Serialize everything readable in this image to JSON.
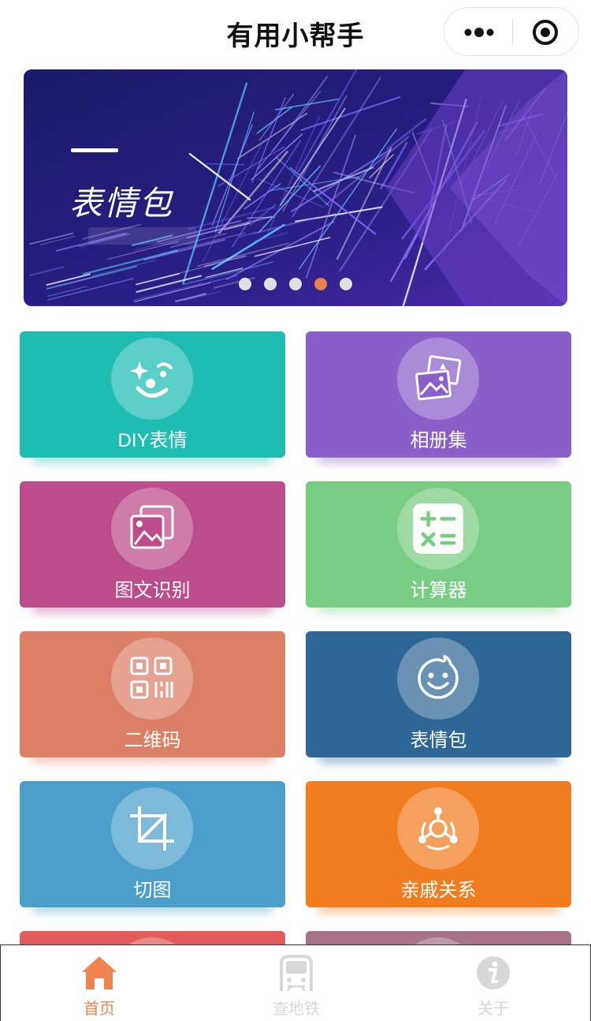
{
  "header": {
    "title": "有用小帮手",
    "more_icon": "more-dots-icon",
    "close_icon": "target-icon"
  },
  "banner": {
    "title": "表情包",
    "slide_count": 5,
    "active_slide": 4
  },
  "tiles": [
    {
      "label": "DIY表情",
      "color": "#1ebcb3",
      "icon": "sparkle-face-icon"
    },
    {
      "label": "相册集",
      "color": "#8b5fc9",
      "icon": "photo-album-icon"
    },
    {
      "label": "图文识别",
      "color": "#bc4c8b",
      "icon": "image-recognition-icon"
    },
    {
      "label": "计算器",
      "color": "#79cd82",
      "icon": "calculator-icon"
    },
    {
      "label": "二维码",
      "color": "#dd7f67",
      "icon": "qr-code-icon"
    },
    {
      "label": "表情包",
      "color": "#2e6796",
      "icon": "smiley-icon"
    },
    {
      "label": "切图",
      "color": "#4c9fca",
      "icon": "crop-icon"
    },
    {
      "label": "亲戚关系",
      "color": "#f27c20",
      "icon": "relationship-icon"
    }
  ],
  "partial_tiles": [
    {
      "color": "#e35b5b"
    },
    {
      "color": "#a8738a"
    }
  ],
  "tabbar": {
    "items": [
      {
        "label": "首页",
        "icon": "home-icon",
        "active": true
      },
      {
        "label": "查地铁",
        "icon": "metro-icon",
        "active": false
      },
      {
        "label": "关于",
        "icon": "info-icon",
        "active": false
      }
    ],
    "active_color": "#f08450",
    "inactive_color": "#d8d8d8"
  }
}
